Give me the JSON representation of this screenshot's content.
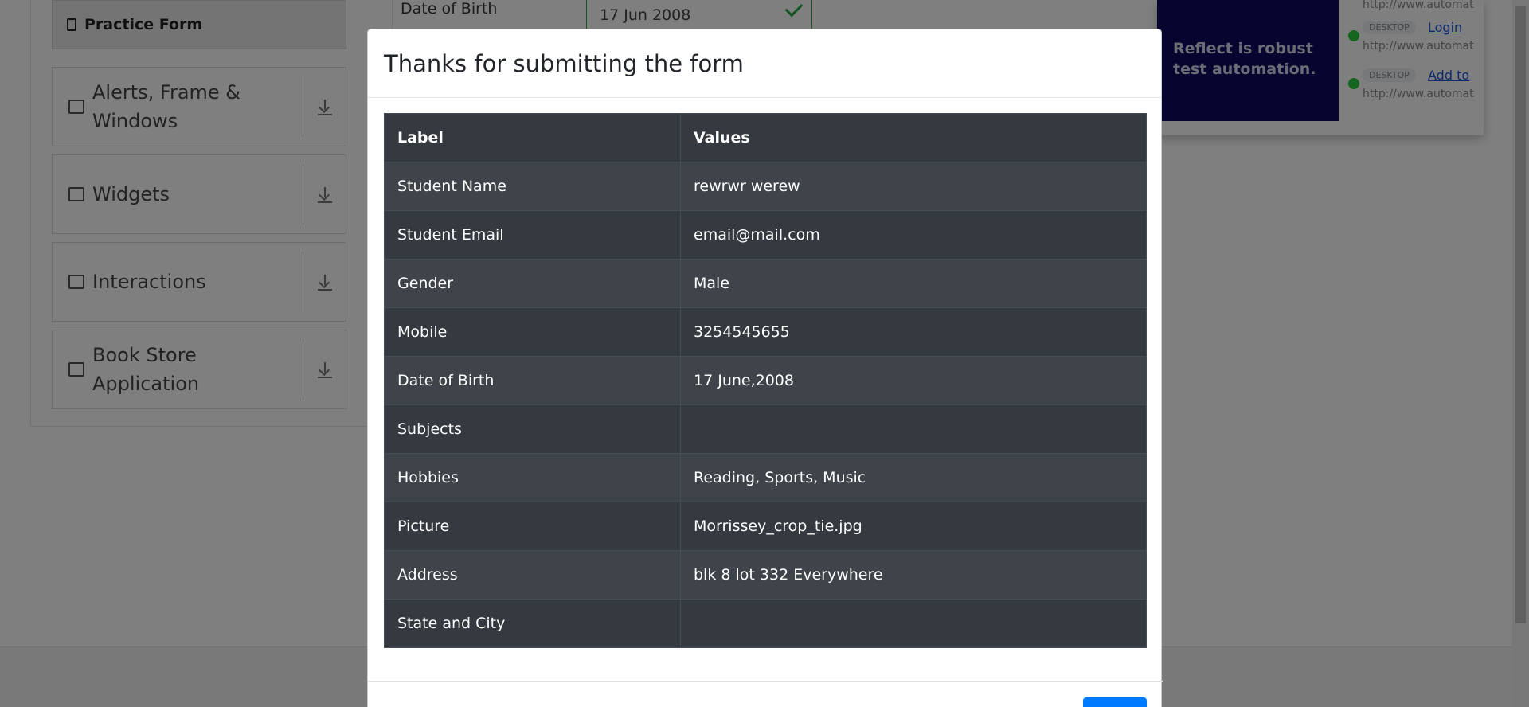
{
  "sidebar": {
    "active_item": "Practice Form",
    "groups": [
      {
        "label": "Alerts, Frame & Windows",
        "icon": "window-icon"
      },
      {
        "label": "Widgets",
        "icon": "widgets-icon"
      },
      {
        "label": "Interactions",
        "icon": "interactions-icon"
      },
      {
        "label": "Book Store Application",
        "icon": "book-icon"
      }
    ]
  },
  "form": {
    "dob_label": "Date of Birth",
    "dob_value": "17 Jun 2008"
  },
  "ad": {
    "headline": "Reflect is robust test automation.",
    "items": [
      {
        "badge": "DESKTOP",
        "link": "Login",
        "url": "http://www.automat"
      },
      {
        "badge": "DESKTOP",
        "link": "Add to",
        "url": "http://www.automat"
      }
    ],
    "top_url": "http://www.automat"
  },
  "modal": {
    "title": "Thanks for submitting the form",
    "columns": [
      "Label",
      "Values"
    ],
    "rows": [
      {
        "label": "Student Name",
        "value": "rewrwr werew"
      },
      {
        "label": "Student Email",
        "value": "email@mail.com"
      },
      {
        "label": "Gender",
        "value": "Male"
      },
      {
        "label": "Mobile",
        "value": "3254545655"
      },
      {
        "label": "Date of Birth",
        "value": "17 June,2008"
      },
      {
        "label": "Subjects",
        "value": ""
      },
      {
        "label": "Hobbies",
        "value": "Reading, Sports, Music"
      },
      {
        "label": "Picture",
        "value": "Morrissey_crop_tie.jpg"
      },
      {
        "label": "Address",
        "value": "blk 8 lot 332 Everywhere"
      },
      {
        "label": "State and City",
        "value": ""
      }
    ]
  },
  "colors": {
    "table_bg": "#343a40",
    "table_row_alt": "#3e444a",
    "success": "#28a745",
    "primary": "#007bff",
    "ad_bg": "#0b0b5e"
  }
}
